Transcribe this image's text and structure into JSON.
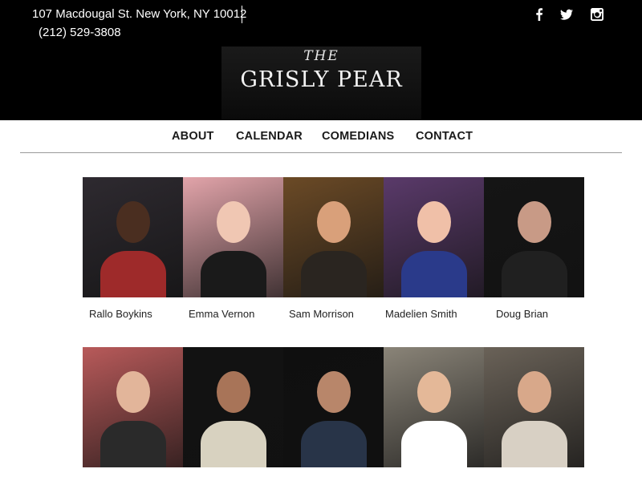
{
  "header": {
    "address": "107 Macdougal St. New York, NY 10012",
    "phone": "(212) 529-3808",
    "social": [
      {
        "icon": "facebook-icon"
      },
      {
        "icon": "twitter-icon"
      },
      {
        "icon": "instagram-icon"
      }
    ],
    "logo": {
      "top_word": "THE",
      "name": "GRISLY PEAR"
    }
  },
  "nav": {
    "items": [
      {
        "label": "ABOUT"
      },
      {
        "label": "CALENDAR"
      },
      {
        "label": "COMEDIANS"
      },
      {
        "label": "CONTACT"
      }
    ]
  },
  "comedians": {
    "row1": [
      {
        "name": "Rallo Boykins",
        "bg": "#2e2a30",
        "skin": "#4a2e20",
        "shirt": "#9e2a2a"
      },
      {
        "name": "Emma Vernon",
        "bg": "#e2a4aa",
        "skin": "#f0c7b3",
        "shirt": "#1a1a1a"
      },
      {
        "name": "Sam Morrison",
        "bg": "#6b4a26",
        "skin": "#d9a07a",
        "shirt": "#2a2520"
      },
      {
        "name": "Madelien Smith",
        "bg": "#5a3a6a",
        "skin": "#f0c0a8",
        "shirt": "#2a3a8a"
      },
      {
        "name": "Doug Brian",
        "bg": "#151515",
        "skin": "#c89a86",
        "shirt": "#202020"
      }
    ],
    "row2": [
      {
        "bg": "#b85a5a",
        "skin": "#e2b59a",
        "shirt": "#2a2a2a"
      },
      {
        "bg": "#121212",
        "skin": "#a87458",
        "shirt": "#d8d2c0"
      },
      {
        "bg": "#0f0f0f",
        "skin": "#b8866a",
        "shirt": "#283448"
      },
      {
        "bg": "#8a8478",
        "skin": "#e4b898",
        "shirt": "#ffffff"
      },
      {
        "bg": "#6a6258",
        "skin": "#d8a88a",
        "shirt": "#d8d0c4"
      }
    ]
  }
}
